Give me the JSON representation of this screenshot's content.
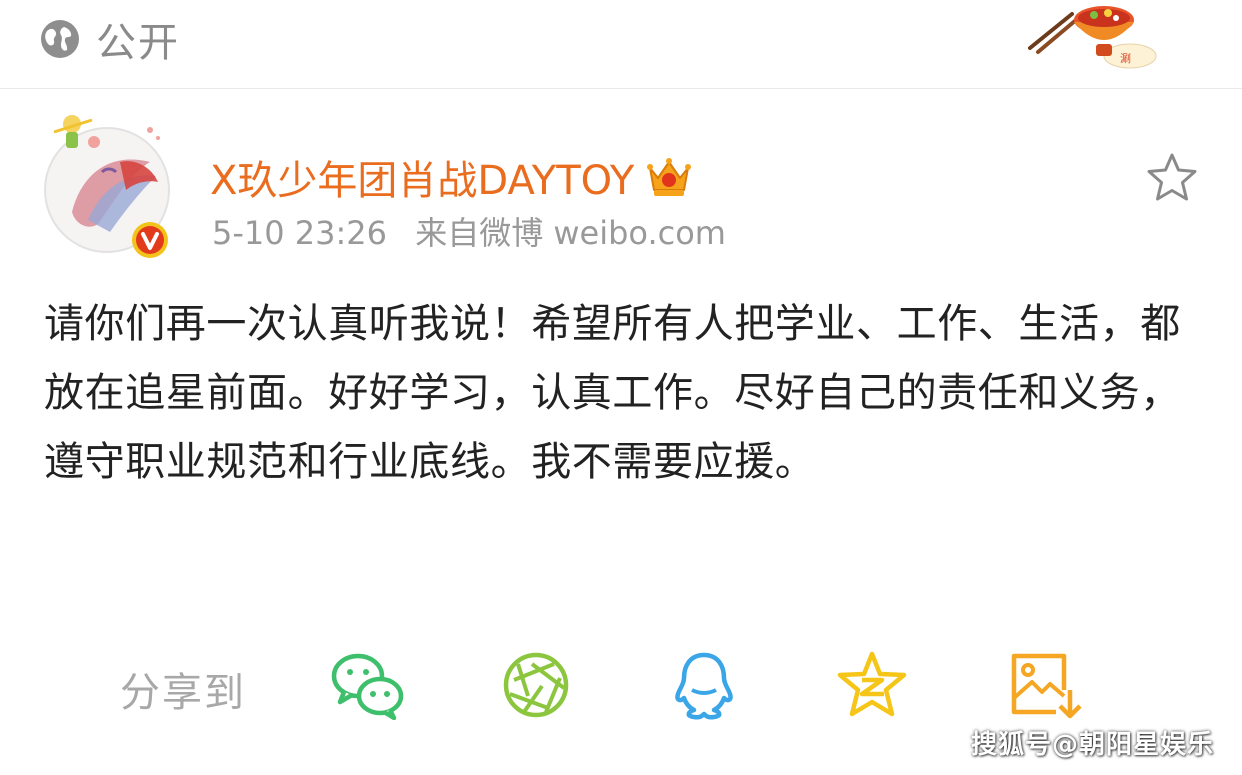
{
  "topbar": {
    "visibility_label": "公开",
    "visibility_icon": "globe-icon",
    "decoration_icon": "hotpot-decoration-icon"
  },
  "post": {
    "author_name": "X玖少年团肖战DAYTOY",
    "author_badge_icon": "crown-vip-icon",
    "verified_icon": "verified-v-icon",
    "timestamp": "5-10 23:26",
    "source": "来自微博 weibo.com",
    "favorite_icon": "star-outline-icon",
    "text": "请你们再一次认真听我说！希望所有人把学业、工作、生活，都放在追星前面。好好学习，认真工作。尽好自己的责任和义务，遵守职业规范和行业底线。我不需要应援。"
  },
  "share": {
    "label": "分享到",
    "targets": [
      {
        "name": "wechat",
        "icon": "wechat-icon",
        "color": "#3dbf6b"
      },
      {
        "name": "moments",
        "icon": "moments-icon",
        "color": "#8cc63f"
      },
      {
        "name": "qq",
        "icon": "qq-icon",
        "color": "#3aa6e8"
      },
      {
        "name": "qzone",
        "icon": "qzone-star-icon",
        "color": "#f5c518"
      },
      {
        "name": "save-image",
        "icon": "save-image-icon",
        "color": "#f5a623"
      }
    ]
  },
  "watermark": "搜狐号@朝阳星娱乐",
  "colors": {
    "author": "#ea6c1e",
    "meta": "#999999",
    "body_text": "#222222"
  }
}
